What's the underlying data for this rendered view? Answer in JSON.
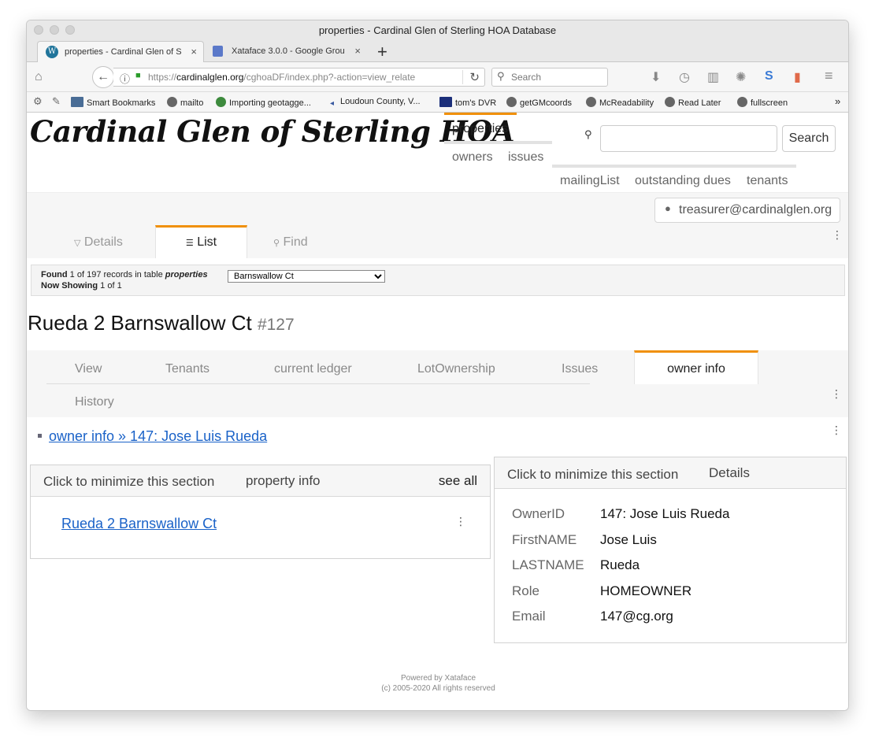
{
  "window": {
    "title": "properties - Cardinal Glen of Sterling HOA Database"
  },
  "browser": {
    "tabs": [
      {
        "label": "properties - Cardinal Glen of S",
        "icon": "wordpress-icon",
        "active": true
      },
      {
        "label": "Xataface 3.0.0 - Google Grou",
        "icon": "google-groups-icon",
        "active": false
      }
    ],
    "url": {
      "prefix": "https://",
      "domain": "cardinalglen.org",
      "path": "/cghoaDF/index.php?-action=view_relate"
    },
    "search_placeholder": "Search",
    "bookmarks": [
      {
        "label": "Smart Bookmarks",
        "icon": "folder-icon"
      },
      {
        "label": "mailto",
        "icon": "globe-icon"
      },
      {
        "label": "Importing geotagge...",
        "icon": "gear-icon"
      },
      {
        "label": "Loudoun County, V...",
        "icon": "arrow-icon"
      },
      {
        "label": "tom's DVR",
        "icon": "monitor-icon"
      },
      {
        "label": "getGMcoords",
        "icon": "globe-icon"
      },
      {
        "label": "McReadability",
        "icon": "globe-icon"
      },
      {
        "label": "Read Later",
        "icon": "globe-icon"
      },
      {
        "label": "fullscreen",
        "icon": "globe-icon"
      }
    ],
    "overflow": "»"
  },
  "site": {
    "logo": "Cardinal Glen of Sterling HOA",
    "nav": {
      "properties": "properties",
      "owners": "owners",
      "issues": "issues",
      "mailingList": "mailingList",
      "outstanding_dues": "outstanding dues",
      "tenants": "tenants"
    },
    "search_button": "Search",
    "user": "treasurer@cardinalglen.org"
  },
  "view_tabs": {
    "details": "Details",
    "list": "List",
    "find": "Find"
  },
  "info": {
    "found_label": "Found",
    "found_count": "1",
    "of_text": "of 197 records in table",
    "table": "properties",
    "now_label": "Now Showing",
    "now_value": "1 of 1",
    "select_value": "Barnswallow Ct"
  },
  "record": {
    "title": "Rueda 2 Barnswallow Ct",
    "id": "#127"
  },
  "record_tabs": {
    "view": "View",
    "tenants": "Tenants",
    "current_ledger": "current ledger",
    "lot_ownership": "LotOwnership",
    "issues": "Issues",
    "owner_info": "owner info",
    "history": "History"
  },
  "breadcrumb": "owner info » 147: Jose Luis Rueda",
  "property_panel": {
    "minimize": "Click to minimize this section",
    "title": "property info",
    "see_all": "see all",
    "link": "Rueda 2 Barnswallow Ct"
  },
  "details_panel": {
    "minimize": "Click to minimize this section",
    "title": "Details",
    "fields": [
      {
        "key": "OwnerID",
        "value": "147: Jose Luis Rueda"
      },
      {
        "key": "FirstNAME",
        "value": "Jose Luis"
      },
      {
        "key": "LASTNAME",
        "value": "Rueda"
      },
      {
        "key": "Role",
        "value": "HOMEOWNER"
      },
      {
        "key": "Email",
        "value": "147@cg.org"
      }
    ]
  },
  "footer": {
    "line1": "Powered by Xataface",
    "line2": "(c) 2005-2020 All rights reserved"
  },
  "colors": {
    "accent": "#f0900a",
    "link": "#1a62c8"
  }
}
